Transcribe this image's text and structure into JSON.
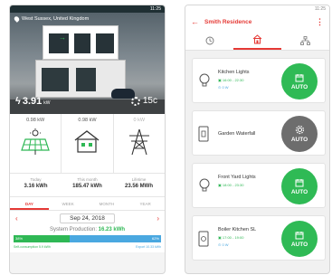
{
  "left": {
    "status_time": "11:25",
    "location": "West Sussex, United Kingdom",
    "power_value": "3.91",
    "power_unit": "kW",
    "temperature": "15c",
    "flows": [
      {
        "value": "0.98 kW",
        "icon": "solar-panel-icon"
      },
      {
        "value": "0.98 kW",
        "icon": "house-icon"
      },
      {
        "value": "0 kW",
        "icon": "power-tower-icon"
      }
    ],
    "totals": [
      {
        "label": "Today",
        "value": "3.16 kWh"
      },
      {
        "label": "This month",
        "value": "185.47 kWh"
      },
      {
        "label": "Lifetime",
        "value": "23.56 MWh"
      }
    ],
    "tabs": [
      "DAY",
      "WEEK",
      "MONTH",
      "YEAR"
    ],
    "active_tab": 0,
    "date": "Sep 24, 2018",
    "production_label": "System Production:",
    "production_value": "16.23 kWh",
    "self_pct": "38%",
    "export_pct": "62%",
    "self_consumption": "Self-consumption 5.9 kWh",
    "export": "Export 10.33 kWh",
    "colors": {
      "green": "#2fb855",
      "blue": "#4aa8e0",
      "red": "#e53935"
    }
  },
  "right": {
    "status_time": "11:25",
    "title": "Smith Residence",
    "tab_icons": [
      "clock-icon",
      "house-icon",
      "sitemap-icon"
    ],
    "active_tab": 1,
    "devices": [
      {
        "name": "Kitchen Lights",
        "schedule": "16:00 - 22:30",
        "power": "0 W",
        "mode": "AUTO",
        "mode_icon": "calendar-icon",
        "icon": "bulb-icon",
        "color": "#2fba55"
      },
      {
        "name": "Garden Waterfall",
        "schedule": "",
        "power": "",
        "mode": "AUTO",
        "mode_icon": "gear-icon",
        "icon": "switch-icon",
        "color": "#6d6d6d"
      },
      {
        "name": "Front Yard Lights",
        "schedule": "18:00 - 23:30",
        "power": "",
        "mode": "AUTO",
        "mode_icon": "calendar-icon",
        "icon": "bulb-icon",
        "color": "#2fba55"
      },
      {
        "name": "Boiler Kitchen SL",
        "schedule": "17:00 - 19:00",
        "power": "0 W",
        "mode": "AUTO",
        "mode_icon": "calendar-icon",
        "icon": "socket-icon",
        "color": "#2fba55"
      }
    ]
  }
}
